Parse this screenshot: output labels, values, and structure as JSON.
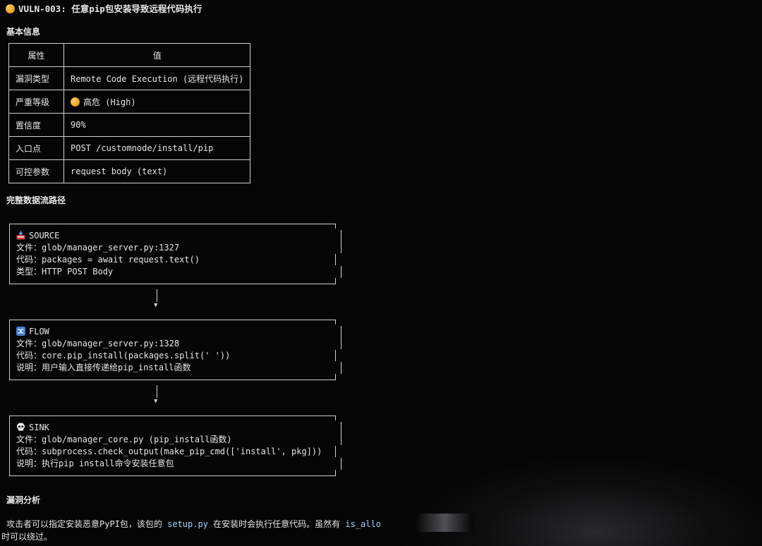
{
  "title": "VULN-003: 任意pip包安装导致远程代码执行",
  "sections": {
    "basic": "基本信息",
    "flow": "完整数据流路径",
    "analysis": "漏洞分析"
  },
  "info_table": {
    "headers": [
      "属性",
      "值"
    ],
    "rows": [
      {
        "key": "漏洞类型",
        "value": "Remote Code Execution (远程代码执行)"
      },
      {
        "key": "严重等级",
        "value": "高危 (High)"
      },
      {
        "key": "置信度",
        "value": "90%"
      },
      {
        "key": "入口点",
        "value": "POST /customnode/install/pip"
      },
      {
        "key": "可控参数",
        "value": "request body (text)"
      }
    ]
  },
  "flow": [
    {
      "label": "SOURCE",
      "icon": "source-icon",
      "lines": [
        "文件：glob/manager_server.py:1327",
        "代码：packages = await request.text()",
        "类型：HTTP POST Body"
      ]
    },
    {
      "label": "FLOW",
      "icon": "flow-shuffle-icon",
      "lines": [
        "文件：glob/manager_server.py:1328",
        "代码：core.pip_install(packages.split(' '))",
        "说明：用户输入直接传递给pip_install函数"
      ]
    },
    {
      "label": "SINK",
      "icon": "skull-icon",
      "lines": [
        "文件：glob/manager_core.py (pip_install函数)",
        "代码：subprocess.check_output(make_pip_cmd(['install', pkg]))",
        "说明：执行pip install命令安装任意包"
      ]
    }
  ],
  "analysis": {
    "part1": "攻击者可以指定安装恶意PyPI包，该包的 ",
    "code1": "setup.py",
    "part2": " 在安装时会执行任意代码。虽然有 ",
    "code2": "is_allo",
    "line2": "时可以绕过。"
  },
  "colors": {
    "background": "#050505",
    "text": "#e6e6e6",
    "severity_orb": "#f0a224",
    "inline_code": "#9fd3ff"
  }
}
